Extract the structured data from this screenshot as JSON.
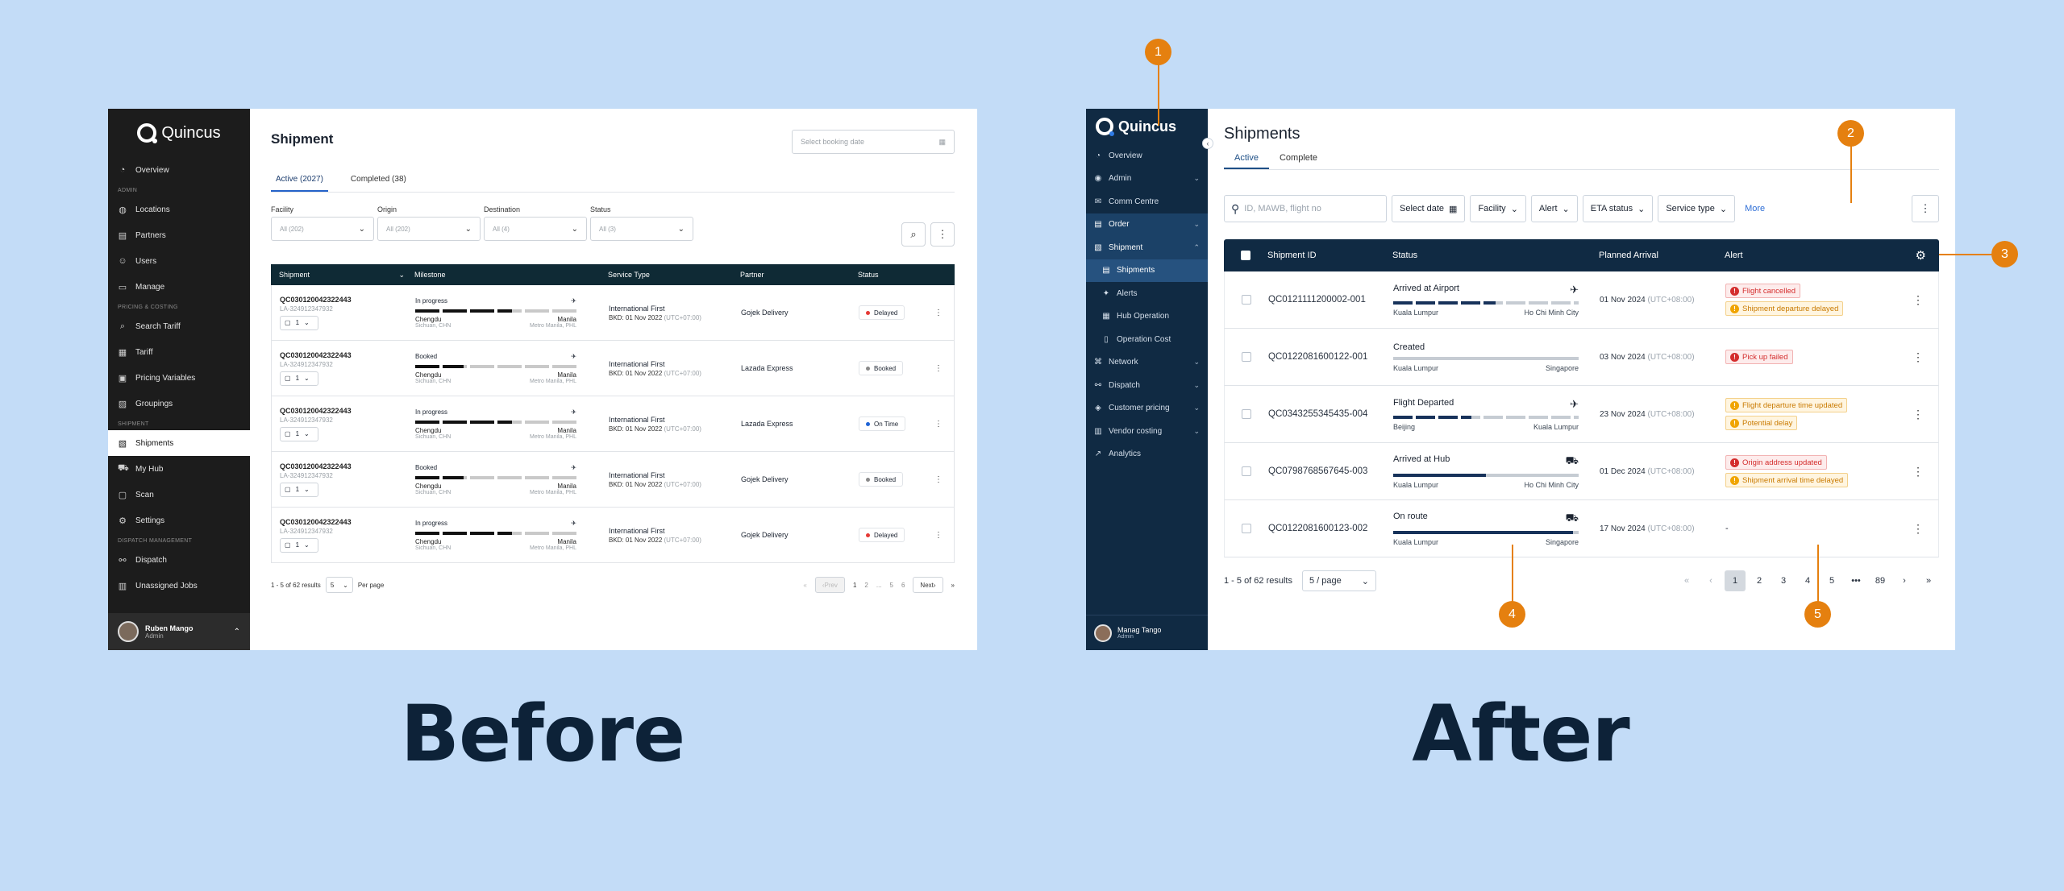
{
  "before": {
    "logo": "Quincus",
    "nav": [
      {
        "type": "item",
        "label": "Overview",
        "icon": "gauge-icon"
      },
      {
        "type": "section",
        "label": "ADMIN"
      },
      {
        "type": "item",
        "label": "Locations",
        "icon": "globe-icon"
      },
      {
        "type": "item",
        "label": "Partners",
        "icon": "building-icon"
      },
      {
        "type": "item",
        "label": "Users",
        "icon": "users-icon"
      },
      {
        "type": "item",
        "label": "Manage",
        "icon": "folder-icon"
      },
      {
        "type": "section",
        "label": "PRICING & COSTING"
      },
      {
        "type": "item",
        "label": "Search Tariff",
        "icon": "search-icon"
      },
      {
        "type": "item",
        "label": "Tariff",
        "icon": "table-icon"
      },
      {
        "type": "item",
        "label": "Pricing Variables",
        "icon": "variables-icon"
      },
      {
        "type": "item",
        "label": "Groupings",
        "icon": "image-icon"
      },
      {
        "type": "section",
        "label": "SHIPMENT"
      },
      {
        "type": "item",
        "label": "Shipments",
        "icon": "shipment-icon",
        "active": true
      },
      {
        "type": "item",
        "label": "My Hub",
        "icon": "truck-icon"
      },
      {
        "type": "item",
        "label": "Scan",
        "icon": "scan-icon"
      },
      {
        "type": "item",
        "label": "Settings",
        "icon": "gear-icon"
      },
      {
        "type": "section",
        "label": "DISPATCH MANAGEMENT"
      },
      {
        "type": "item",
        "label": "Dispatch",
        "icon": "dispatch-icon"
      },
      {
        "type": "item",
        "label": "Unassigned Jobs",
        "icon": "jobs-icon"
      }
    ],
    "user": {
      "name": "Ruben Mango",
      "role": "Admin"
    },
    "title": "Shipment",
    "date_placeholder": "Select booking date",
    "tabs": [
      "Active (2027)",
      "Completed (38)"
    ],
    "filters": [
      {
        "label": "Facility",
        "value": "All (202)"
      },
      {
        "label": "Origin",
        "value": "All (202)"
      },
      {
        "label": "Destination",
        "value": "All (4)"
      },
      {
        "label": "Status",
        "value": "All (3)"
      }
    ],
    "columns": [
      "Shipment",
      "Milestone",
      "Service Type",
      "Partner",
      "Status"
    ],
    "rows": [
      {
        "id": "QC030120042322443",
        "sub": "LA-324912347932",
        "qty": "1",
        "milestone": "In progress",
        "progress": 0.6,
        "from": "Chengdu",
        "to": "Manila",
        "from2": "Sichuan, CHN",
        "to2": "Metro Manila, PHL",
        "service": "International First",
        "bkd": "BKD: 01 Nov 2022",
        "tz": "(UTC+07:00)",
        "partner": "Gojek Delivery",
        "status": "Delayed",
        "status_color": "#e53935"
      },
      {
        "id": "QC030120042322443",
        "sub": "LA-324912347932",
        "qty": "1",
        "milestone": "Booked",
        "progress": 0.3,
        "from": "Chengdu",
        "to": "Manila",
        "from2": "Sichuan, CHN",
        "to2": "Metro Manila, PHL",
        "service": "International First",
        "bkd": "BKD: 01 Nov 2022",
        "tz": "(UTC+07:00)",
        "partner": "Lazada Express",
        "status": "Booked",
        "status_color": "#8a8a8a"
      },
      {
        "id": "QC030120042322443",
        "sub": "LA-324912347932",
        "qty": "1",
        "milestone": "In progress",
        "progress": 0.6,
        "from": "Chengdu",
        "to": "Manila",
        "from2": "Sichuan, CHN",
        "to2": "Metro Manila, PHL",
        "service": "International First",
        "bkd": "BKD: 01 Nov 2022",
        "tz": "(UTC+07:00)",
        "partner": "Lazada Express",
        "status": "On Time",
        "status_color": "#1e63d6"
      },
      {
        "id": "QC030120042322443",
        "sub": "LA-324912347932",
        "qty": "1",
        "milestone": "Booked",
        "progress": 0.3,
        "from": "Chengdu",
        "to": "Manila",
        "from2": "Sichuan, CHN",
        "to2": "Metro Manila, PHL",
        "service": "International First",
        "bkd": "BKD: 01 Nov 2022",
        "tz": "(UTC+07:00)",
        "partner": "Gojek Delivery",
        "status": "Booked",
        "status_color": "#8a8a8a"
      },
      {
        "id": "QC030120042322443",
        "sub": "LA-324912347932",
        "qty": "1",
        "milestone": "In progress",
        "progress": 0.6,
        "from": "Chengdu",
        "to": "Manila",
        "from2": "Sichuan, CHN",
        "to2": "Metro Manila, PHL",
        "service": "International First",
        "bkd": "BKD: 01 Nov 2022",
        "tz": "(UTC+07:00)",
        "partner": "Gojek Delivery",
        "status": "Delayed",
        "status_color": "#e53935"
      }
    ],
    "footer": {
      "results": "1 - 5 of 62 results",
      "per_page_value": "5",
      "per_page_label": "Per page",
      "prev": "Prev",
      "pages": [
        "1",
        "2",
        "...",
        "5",
        "6"
      ],
      "next": "Next"
    }
  },
  "after": {
    "logo": "Quincus",
    "nav": [
      {
        "label": "Overview",
        "icon": "gauge-icon"
      },
      {
        "label": "Admin",
        "icon": "admin-icon",
        "chevron": "down"
      },
      {
        "label": "Comm Centre",
        "icon": "chat-icon"
      },
      {
        "label": "Order",
        "icon": "order-icon",
        "chevron": "down",
        "selected": true
      },
      {
        "label": "Shipment",
        "icon": "shipment-icon",
        "chevron": "up",
        "selected": true
      },
      {
        "label": "Shipments",
        "icon": "list-icon",
        "child": true,
        "current": true
      },
      {
        "label": "Alerts",
        "icon": "alert-icon",
        "child": true
      },
      {
        "label": "Hub Operation",
        "icon": "hub-icon",
        "child": true
      },
      {
        "label": "Operation Cost",
        "icon": "cost-icon",
        "child": true
      },
      {
        "label": "Network",
        "icon": "network-icon",
        "chevron": "down"
      },
      {
        "label": "Dispatch",
        "icon": "dispatch-icon",
        "chevron": "down"
      },
      {
        "label": "Customer pricing",
        "icon": "tag-icon",
        "chevron": "down"
      },
      {
        "label": "Vendor costing",
        "icon": "vendor-icon",
        "chevron": "down"
      },
      {
        "label": "Analytics",
        "icon": "analytics-icon"
      }
    ],
    "user": {
      "name": "Manag Tango",
      "role": "Admin"
    },
    "title": "Shipments",
    "tabs": [
      "Active",
      "Complete"
    ],
    "search_placeholder": "ID, MAWB, flight no",
    "chips": [
      "Select date",
      "Facility",
      "Alert",
      "ETA status",
      "Service type"
    ],
    "more": "More",
    "columns": [
      "Shipment ID",
      "Status",
      "Planned Arrival",
      "Alert"
    ],
    "rows": [
      {
        "id": "QC0121111200002-001",
        "status": "Arrived at Airport",
        "mode": "plane",
        "progress": 0.55,
        "solid": false,
        "from": "Kuala Lumpur",
        "to": "Ho Chi Minh City",
        "date": "01 Nov 2024",
        "tz": "(UTC+08:00)",
        "alerts": [
          {
            "text": "Flight cancelled",
            "level": "red"
          },
          {
            "text": "Shipment departure delayed",
            "level": "orange"
          }
        ]
      },
      {
        "id": "QC0122081600122-001",
        "status": "Created",
        "mode": "none",
        "progress": 0.0,
        "solid": true,
        "from": "Kuala Lumpur",
        "to": "Singapore",
        "date": "03 Nov 2024",
        "tz": "(UTC+08:00)",
        "alerts": [
          {
            "text": "Pick up failed",
            "level": "red"
          }
        ]
      },
      {
        "id": "QC0343255345435-004",
        "status": "Flight Departed",
        "mode": "plane",
        "progress": 0.42,
        "solid": false,
        "from": "Beijing",
        "to": "Kuala Lumpur",
        "date": "23 Nov 2024",
        "tz": "(UTC+08:00)",
        "alerts": [
          {
            "text": "Flight departure time updated",
            "level": "orange"
          },
          {
            "text": "Potential delay",
            "level": "orange"
          }
        ]
      },
      {
        "id": "QC0798768567645-003",
        "status": "Arrived at Hub",
        "mode": "truck",
        "progress": 0.5,
        "solid": true,
        "from": "Kuala Lumpur",
        "to": "Ho Chi Minh City",
        "date": "01 Dec 2024",
        "tz": "(UTC+08:00)",
        "alerts": [
          {
            "text": "Origin address updated",
            "level": "red"
          },
          {
            "text": "Shipment arrival time delayed",
            "level": "orange"
          }
        ]
      },
      {
        "id": "QC0122081600123-002",
        "status": "On route",
        "mode": "truck",
        "progress": 0.97,
        "solid": true,
        "from": "Kuala Lumpur",
        "to": "Singapore",
        "date": "17 Nov 2024",
        "tz": "(UTC+08:00)",
        "alerts": [],
        "empty_alert": "-"
      }
    ],
    "footer": {
      "results": "1 - 5 of 62 results",
      "per_page": "5 / page",
      "pages": [
        "1",
        "2",
        "3",
        "4",
        "5",
        "•••",
        "89"
      ]
    }
  },
  "annotations": [
    "1",
    "2",
    "3",
    "4",
    "5"
  ],
  "captions": {
    "before": "Before",
    "after": "After"
  },
  "colors": {
    "background": "#c3dcf7",
    "annotation": "#e5800f",
    "after_navy": "#102a43",
    "before_dark": "#1c1c1c"
  }
}
